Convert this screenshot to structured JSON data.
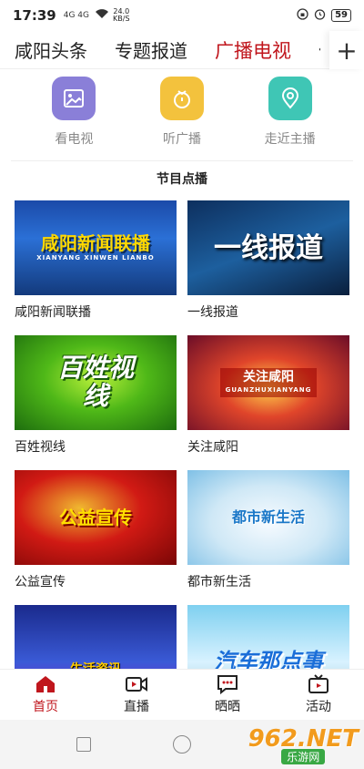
{
  "status": {
    "time": "17:39",
    "signal": "4G 4G",
    "speed_value": "24.0",
    "speed_unit": "KB/S",
    "battery": "59"
  },
  "topnav": {
    "tabs": [
      "咸阳头条",
      "专题报道",
      "广播电视",
      "便"
    ],
    "active_index": 2
  },
  "quick": [
    {
      "label": "看电视",
      "icon": "image-icon",
      "color": "#8a7fd8"
    },
    {
      "label": "听广播",
      "icon": "radio-icon",
      "color": "#f3c23d"
    },
    {
      "label": "走近主播",
      "icon": "location-pin-icon",
      "color": "#3fc6b5"
    }
  ],
  "section_title": "节目点播",
  "programs": [
    {
      "title": "咸阳新闻联播",
      "overlay": "咸阳新闻联播",
      "sub": "XIANYANG XINWEN LIANBO"
    },
    {
      "title": "一线报道",
      "overlay": "一线报道"
    },
    {
      "title": "百姓视线",
      "overlay": "百姓视线"
    },
    {
      "title": "关注咸阳",
      "overlay": "关注咸阳",
      "sub": "GUANZHUXIANYANG"
    },
    {
      "title": "公益宣传",
      "overlay": "公益宣传"
    },
    {
      "title": "都市新生活",
      "overlay": "都市新生活"
    },
    {
      "title": "",
      "overlay": "生活资讯"
    },
    {
      "title": "",
      "overlay": "汽车那点事"
    }
  ],
  "bottomnav": {
    "items": [
      "首页",
      "直播",
      "晒晒",
      "活动"
    ],
    "active_index": 0
  },
  "watermark": {
    "brand": "962.NET",
    "sub": "乐游网"
  },
  "colors": {
    "accent": "#c0161d"
  }
}
